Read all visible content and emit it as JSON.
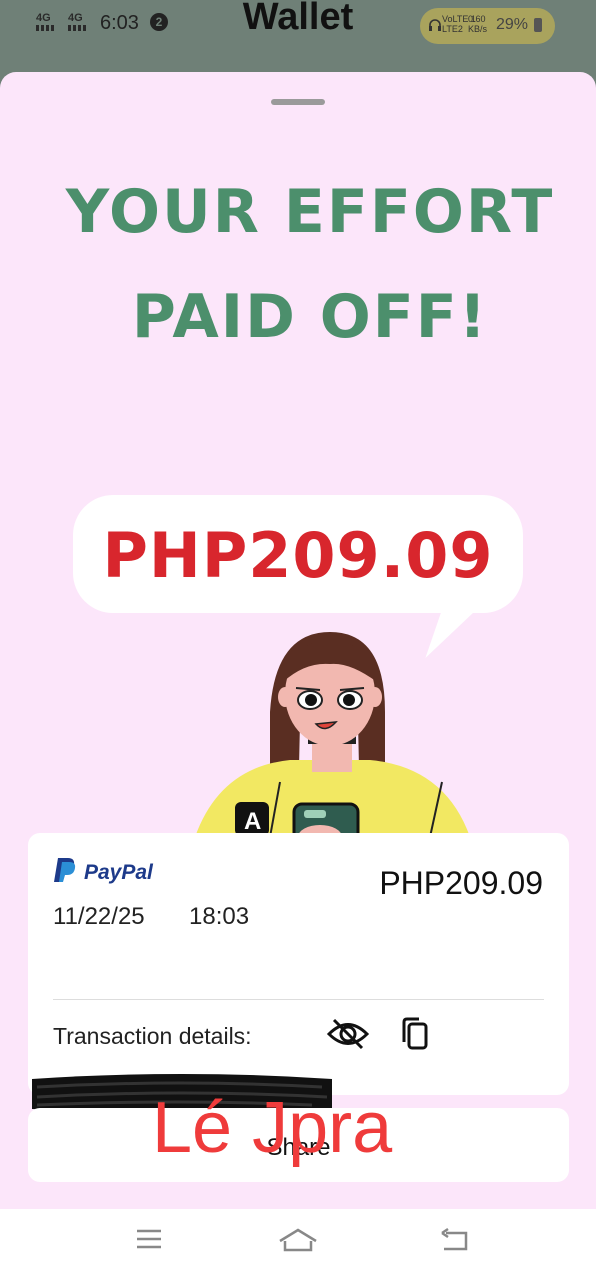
{
  "status": {
    "sig1": "4G",
    "sig2": "4G",
    "time": "6:03",
    "notif": "2",
    "lte1": "VoLTE 1",
    "lte2": "LTE2",
    "speed1": "0.60",
    "speed2": "KB/s",
    "battery": "29%"
  },
  "app": {
    "title": "Wallet"
  },
  "promo": {
    "line1": "YOUR EFFORT",
    "line2": "PAID OFF!",
    "amount": "PHP209.09"
  },
  "transaction": {
    "provider": "PayPal",
    "amount": "PHP209.09",
    "date": "11/22/25",
    "time": "18:03",
    "details_label": "Transaction details:"
  },
  "actions": {
    "share_label": "Share"
  },
  "overlay": {
    "watermark": "Lé Jpra"
  },
  "colors": {
    "sheet_bg": "#fce6fa",
    "headline": "#4c8f6c",
    "promo_amount": "#d8262d",
    "paypal_blue": "#1d3a8a"
  },
  "icons": [
    "eye-slash-icon",
    "copy-icon",
    "menu-icon",
    "home-icon",
    "back-icon",
    "paypal-logo",
    "headphones-icon",
    "battery-icon"
  ]
}
